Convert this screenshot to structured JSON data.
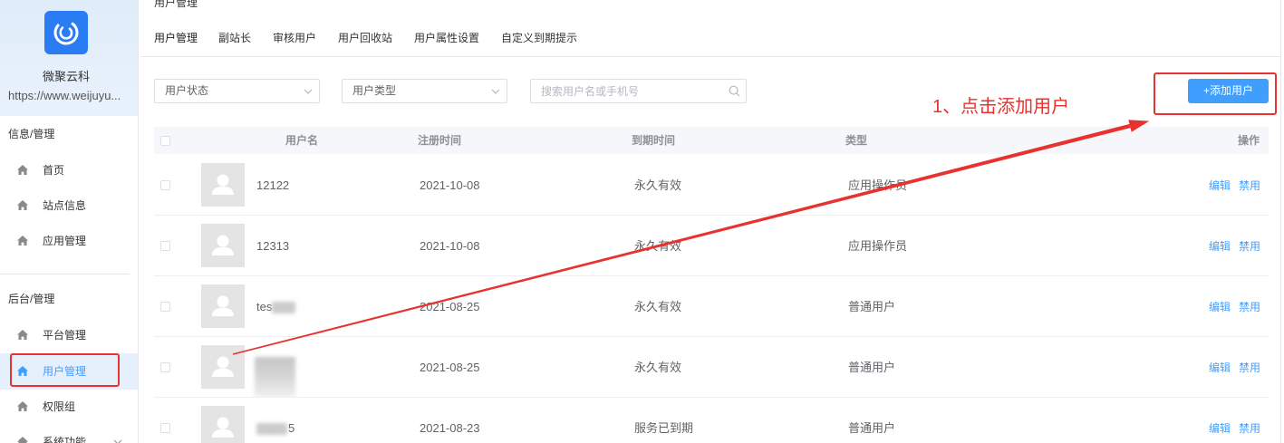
{
  "sidebar": {
    "brand": {
      "name": "微聚云科",
      "url": "https://www.weijuyu...",
      "logo_icon": "swirl-logo-icon"
    },
    "groups": [
      {
        "title": "信息/管理",
        "items": [
          {
            "label": "首页",
            "icon": "home-icon"
          },
          {
            "label": "站点信息",
            "icon": "home-icon"
          },
          {
            "label": "应用管理",
            "icon": "home-icon"
          }
        ]
      },
      {
        "title": "后台/管理",
        "items": [
          {
            "label": "平台管理",
            "icon": "home-icon"
          },
          {
            "label": "用户管理",
            "icon": "home-icon",
            "active": true
          },
          {
            "label": "权限组",
            "icon": "home-icon"
          },
          {
            "label": "系统功能",
            "icon": "home-icon",
            "trailing_icon": "chevron-down-icon"
          }
        ]
      }
    ]
  },
  "page": {
    "title": "用户管理"
  },
  "tabs": [
    {
      "label": "用户管理",
      "active": true
    },
    {
      "label": "副站长"
    },
    {
      "label": "审核用户"
    },
    {
      "label": "用户回收站"
    },
    {
      "label": "用户属性设置"
    },
    {
      "label": "自定义到期提示"
    }
  ],
  "filters": {
    "status_placeholder": "用户状态",
    "type_placeholder": "用户类型",
    "search_placeholder": "搜索用户名或手机号",
    "search_icon": "search-icon"
  },
  "toolbar": {
    "add_user_label": "+添加用户"
  },
  "annotation": {
    "text": "1、点击添加用户"
  },
  "table": {
    "columns": [
      "用户名",
      "注册时间",
      "到期时间",
      "类型",
      "操作"
    ],
    "rows": [
      {
        "username": "12122",
        "registered": "2021-10-08",
        "expires": "永久有效",
        "type": "应用操作员",
        "actions": [
          "编辑",
          "禁用"
        ]
      },
      {
        "username": "12313",
        "registered": "2021-10-08",
        "expires": "永久有效",
        "type": "应用操作员",
        "actions": [
          "编辑",
          "禁用"
        ]
      },
      {
        "username": "tes",
        "registered": "2021-08-25",
        "expires": "永久有效",
        "type": "普通用户",
        "actions": [
          "编辑",
          "禁用"
        ]
      },
      {
        "registered": "2021-08-25",
        "expires": "永久有效",
        "type": "普通用户",
        "actions": [
          "编辑",
          "禁用"
        ]
      },
      {
        "username": "5",
        "registered": "2021-08-23",
        "expires": "服务已到期",
        "type": "普通用户",
        "actions": [
          "编辑",
          "禁用"
        ]
      }
    ]
  },
  "colors": {
    "accent": "#409eff",
    "logo": "#2a7cf3",
    "annotation": "#e8322f",
    "active_nav_bg": "#e6f0fc",
    "table_header_bg": "#f5f7fa"
  }
}
